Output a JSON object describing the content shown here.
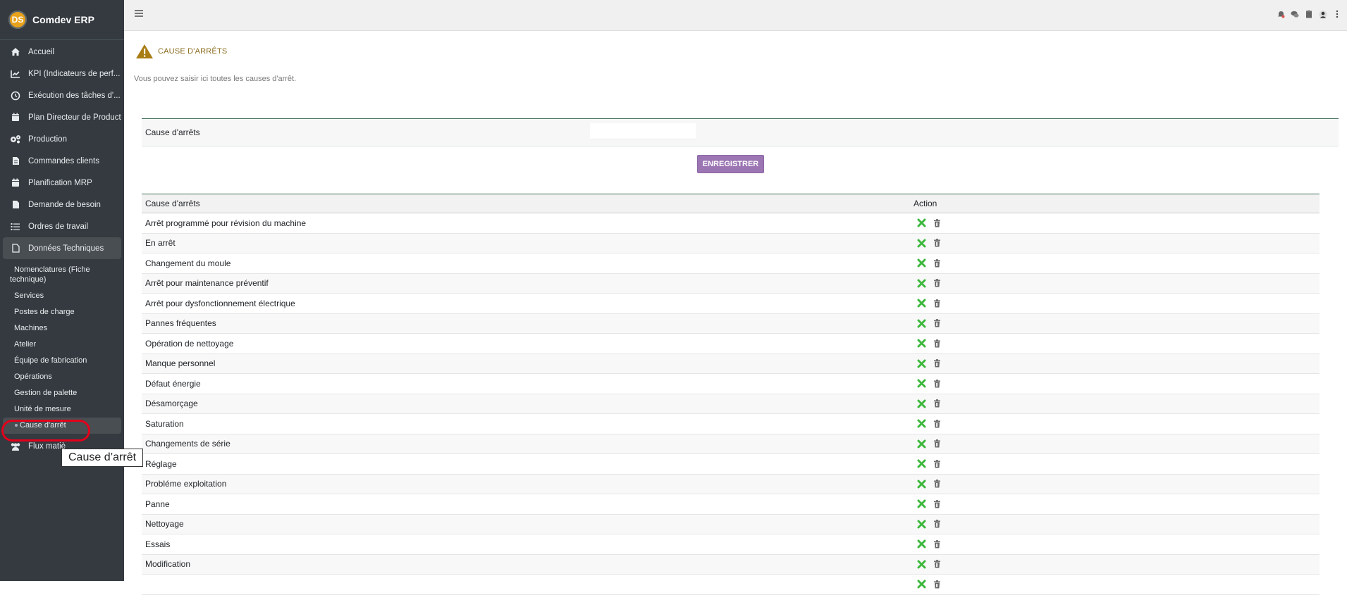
{
  "app": {
    "name": "Comdev ERP",
    "logo_text": "DS"
  },
  "sidebar": {
    "items": [
      {
        "label": "Accueil",
        "icon": "home-icon"
      },
      {
        "label": "KPI (Indicateurs de perf...",
        "icon": "chart-line-icon"
      },
      {
        "label": "Exécution des tâches d'...",
        "icon": "clock-icon"
      },
      {
        "label": "Plan Directeur de Productio",
        "icon": "calendar-icon"
      },
      {
        "label": "Production",
        "icon": "gears-icon"
      },
      {
        "label": "Commandes clients",
        "icon": "file-icon"
      },
      {
        "label": "Planification MRP",
        "icon": "calendar-icon"
      },
      {
        "label": "Demande de besoin",
        "icon": "file-icon"
      },
      {
        "label": "Ordres de travail",
        "icon": "tasks-icon"
      },
      {
        "label": "Données Techniques",
        "icon": "file-outline-icon"
      }
    ],
    "sub_items": [
      "Nomenclatures (Fiche technique)",
      "Services",
      "Postes de charge",
      "Machines",
      "Atelier",
      "Équipe de fabrication",
      "Opérations",
      "Gestion de palette",
      "Unité de mesure",
      "Cause d'arrêt"
    ],
    "after_item": {
      "label": "Flux matiè",
      "icon": "users-icon"
    }
  },
  "tooltip": "Cause d’arrêt",
  "page": {
    "title": "CAUSE D'ARRÊTS",
    "subtitle": "Vous pouvez saisir ici toutes les causes d'arrêt."
  },
  "form": {
    "label": "Cause d'arrêts",
    "value": "",
    "placeholder": "",
    "save_label": "ENREGISTRER"
  },
  "table": {
    "headers": [
      "Cause d'arrêts",
      "Action"
    ],
    "rows": [
      "Arrêt programmé pour révision du machine",
      "En arrêt",
      "Changement du moule",
      "Arrêt pour maintenance préventif",
      "Arrêt pour dysfonctionnement électrique",
      "Pannes fréquentes",
      "Opération de nettoyage",
      "Manque personnel",
      "Défaut énergie",
      "Désamorçage",
      "Saturation",
      "Changements de série",
      "Réglage",
      "Probléme exploitation",
      "Panne",
      "Nettoyage",
      "Essais",
      "Modification",
      ""
    ]
  },
  "colors": {
    "sidebar_bg": "#343a40",
    "accent_button": "#9b76b3",
    "edit_icon": "#3cb83c",
    "delete_icon": "#666666",
    "warning_icon": "#b8860b",
    "highlight": "#e3001b"
  }
}
